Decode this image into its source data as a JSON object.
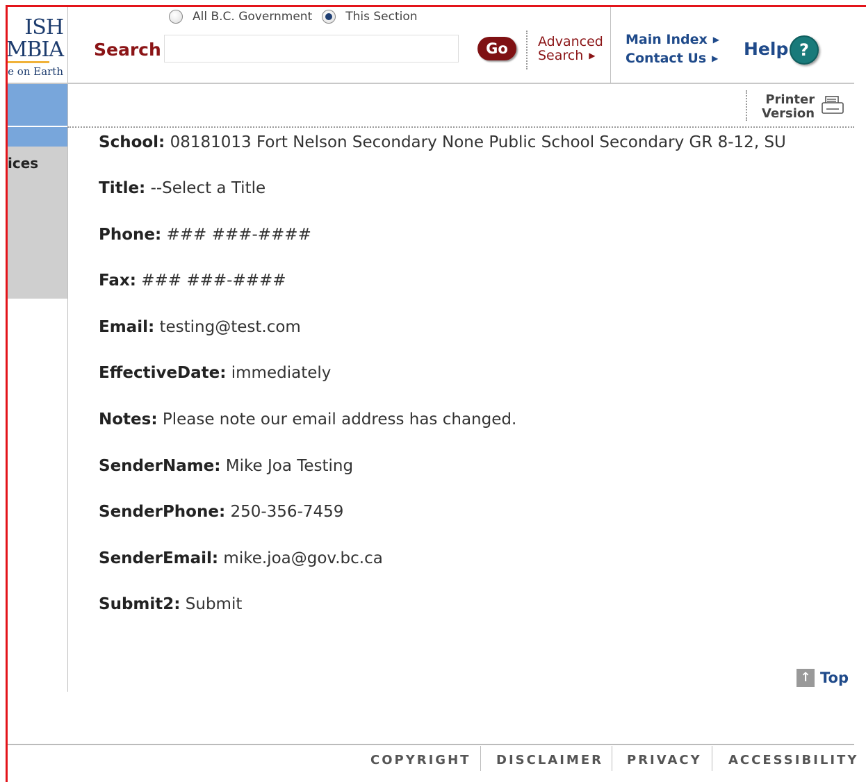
{
  "logo": {
    "line1": "ISH",
    "line2": "MBIA",
    "tagline": "e on Earth"
  },
  "search": {
    "scope_options": [
      "All B.C. Government",
      "This Section"
    ],
    "selected_scope": "This Section",
    "label": "Search",
    "input_value": "",
    "go_label": "Go",
    "advanced_line1": "Advanced",
    "advanced_line2": "Search"
  },
  "nav": {
    "main_index": "Main Index",
    "contact_us": "Contact Us",
    "help": "Help",
    "help_icon_glyph": "?"
  },
  "sidebar": {
    "item_text": "ices"
  },
  "printer": {
    "line1": "Printer",
    "line2": "Version"
  },
  "fields": [
    {
      "label": "School:",
      "value": "08181013 Fort Nelson Secondary None Public School Secondary GR 8-12, SU"
    },
    {
      "label": "Title:",
      "value": "--Select a Title"
    },
    {
      "label": "Phone:",
      "value": "### ###-####"
    },
    {
      "label": "Fax:",
      "value": "### ###-####"
    },
    {
      "label": "Email:",
      "value": "testing@test.com"
    },
    {
      "label": "EffectiveDate:",
      "value": "immediately"
    },
    {
      "label": "Notes:",
      "value": "Please note our email address has changed."
    },
    {
      "label": "SenderName:",
      "value": "Mike Joa Testing"
    },
    {
      "label": "SenderPhone:",
      "value": "250-356-7459"
    },
    {
      "label": "SenderEmail:",
      "value": "mike.joa@gov.bc.ca"
    },
    {
      "label": "Submit2:",
      "value": "Submit"
    }
  ],
  "top_link": "Top",
  "footer": [
    "COPYRIGHT",
    "DISCLAIMER",
    "PRIVACY",
    "ACCESSIBILITY"
  ],
  "colors": {
    "frame_red": "#e3141a",
    "brand_maroon": "#8b1416",
    "link_blue": "#1f4a8a",
    "sidebar_blue": "#78a6db",
    "sidebar_grey": "#cfcfcf"
  }
}
